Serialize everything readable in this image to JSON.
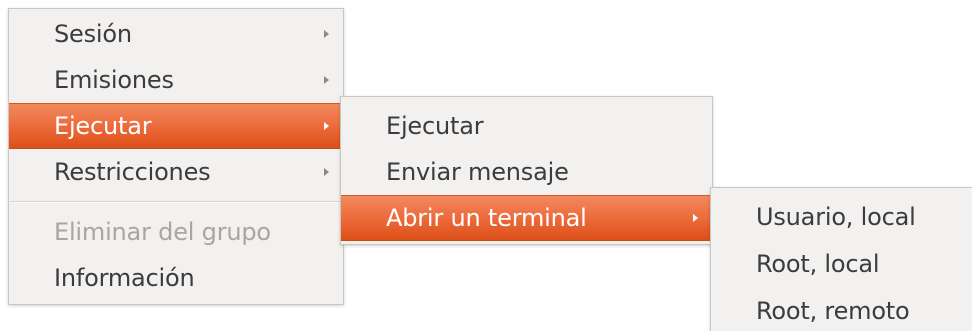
{
  "menu_main": {
    "items": [
      {
        "label": "Sesión",
        "submenu_arrow": "submenu-arrow-icon"
      },
      {
        "label": "Emisiones",
        "submenu_arrow": "submenu-arrow-icon"
      },
      {
        "label": "Ejecutar",
        "submenu_arrow": "submenu-arrow-icon",
        "state": "selected"
      },
      {
        "label": "Restricciones",
        "submenu_arrow": "submenu-arrow-icon"
      },
      {
        "label": "Eliminar del grupo",
        "state": "disabled"
      },
      {
        "label": "Información"
      }
    ]
  },
  "menu_ejecutar": {
    "items": [
      {
        "label": "Ejecutar"
      },
      {
        "label": "Enviar mensaje"
      },
      {
        "label": "Abrir un terminal",
        "submenu_arrow": "submenu-arrow-icon",
        "state": "selected"
      }
    ]
  },
  "menu_terminal": {
    "items": [
      {
        "label": "Usuario, local"
      },
      {
        "label": "Root, local"
      },
      {
        "label": "Root, remoto"
      }
    ]
  },
  "colors": {
    "menu_background": "#f2f1f0",
    "text": "#3c3c3c",
    "disabled_text": "#a8a6a3",
    "highlight": "#ec6b3c",
    "highlight_text": "#ffffff"
  }
}
